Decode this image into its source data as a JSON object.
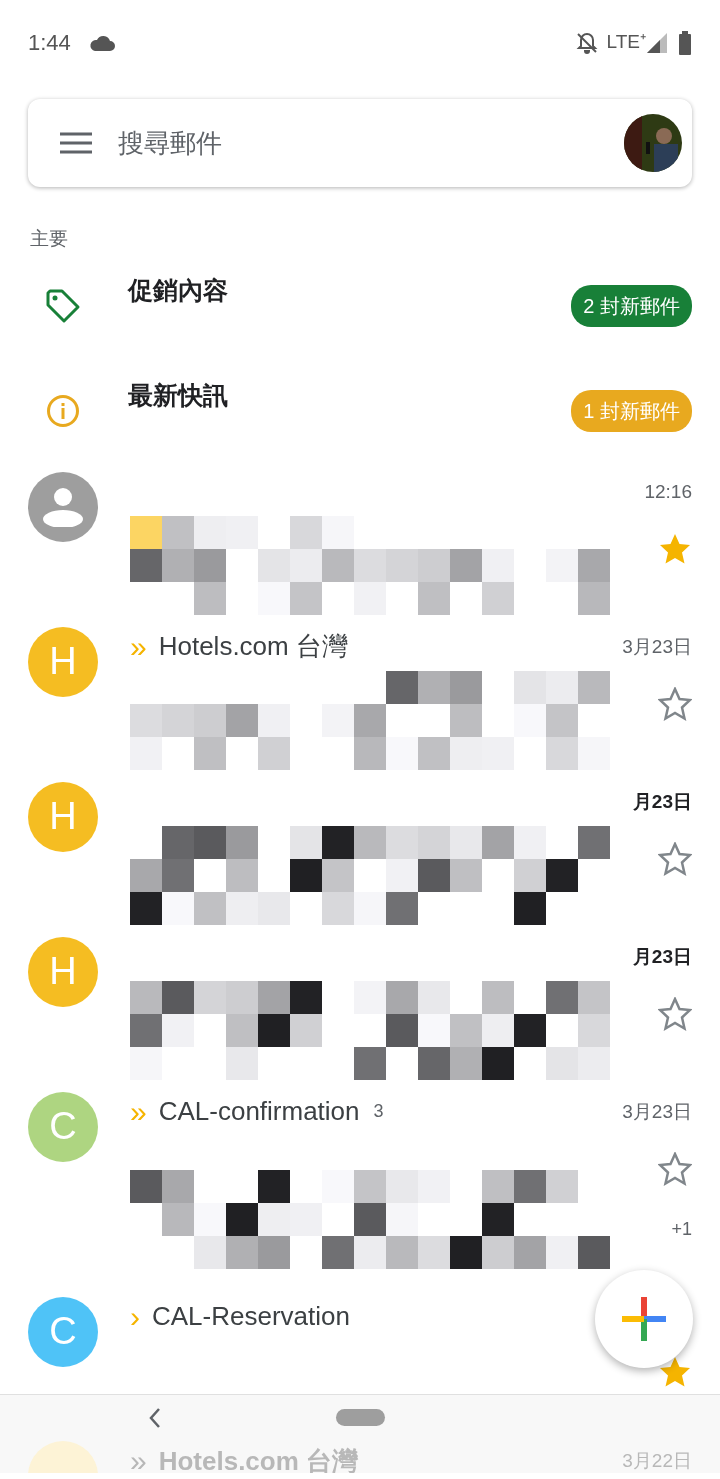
{
  "status_bar": {
    "time": "1:44",
    "network": "LTE⁺"
  },
  "search": {
    "placeholder": "搜尋郵件"
  },
  "section_label": "主要",
  "categories": [
    {
      "kind": "promotions",
      "title": "促銷內容",
      "badge": "2 封新郵件",
      "color": "#188038"
    },
    {
      "kind": "updates",
      "title": "最新快訊",
      "badge": "1 封新郵件",
      "color": "#e8a91f"
    }
  ],
  "emails": [
    {
      "avatar": {
        "kind": "person",
        "color": "#9e9e9e"
      },
      "date": "12:16",
      "unread": false,
      "starred": true,
      "redacted": true
    },
    {
      "avatar": {
        "kind": "letter",
        "letter": "H",
        "color": "#f5bd22"
      },
      "importance": "»",
      "sender": "Hotels.com 台灣",
      "date": "3月23日",
      "unread": false,
      "starred": false,
      "redacted": true
    },
    {
      "avatar": {
        "kind": "letter",
        "letter": "H",
        "color": "#f5bd22"
      },
      "date": "月23日",
      "unread": true,
      "starred": false,
      "redacted": true
    },
    {
      "avatar": {
        "kind": "letter",
        "letter": "H",
        "color": "#f5bd22"
      },
      "date": "月23日",
      "unread": true,
      "starred": false,
      "redacted": true
    },
    {
      "avatar": {
        "kind": "letter",
        "letter": "C",
        "color": "#aed581"
      },
      "importance": "»",
      "sender": "CAL-confirmation",
      "count": "3",
      "date": "3月23日",
      "unread": false,
      "starred": false,
      "redacted": true,
      "extra": "+1"
    },
    {
      "avatar": {
        "kind": "letter",
        "letter": "C",
        "color": "#4fc3f7"
      },
      "importance": "›",
      "sender": "CAL-Reservation",
      "unread": false,
      "starred": true,
      "redacted": false
    },
    {
      "avatar": {
        "kind": "blank",
        "color": "#fdf3d6"
      },
      "importance": "»",
      "sender": "Hotels.com 台灣",
      "date": "3月22日",
      "unread": false,
      "starred": false,
      "redacted": false,
      "faded": true
    }
  ]
}
